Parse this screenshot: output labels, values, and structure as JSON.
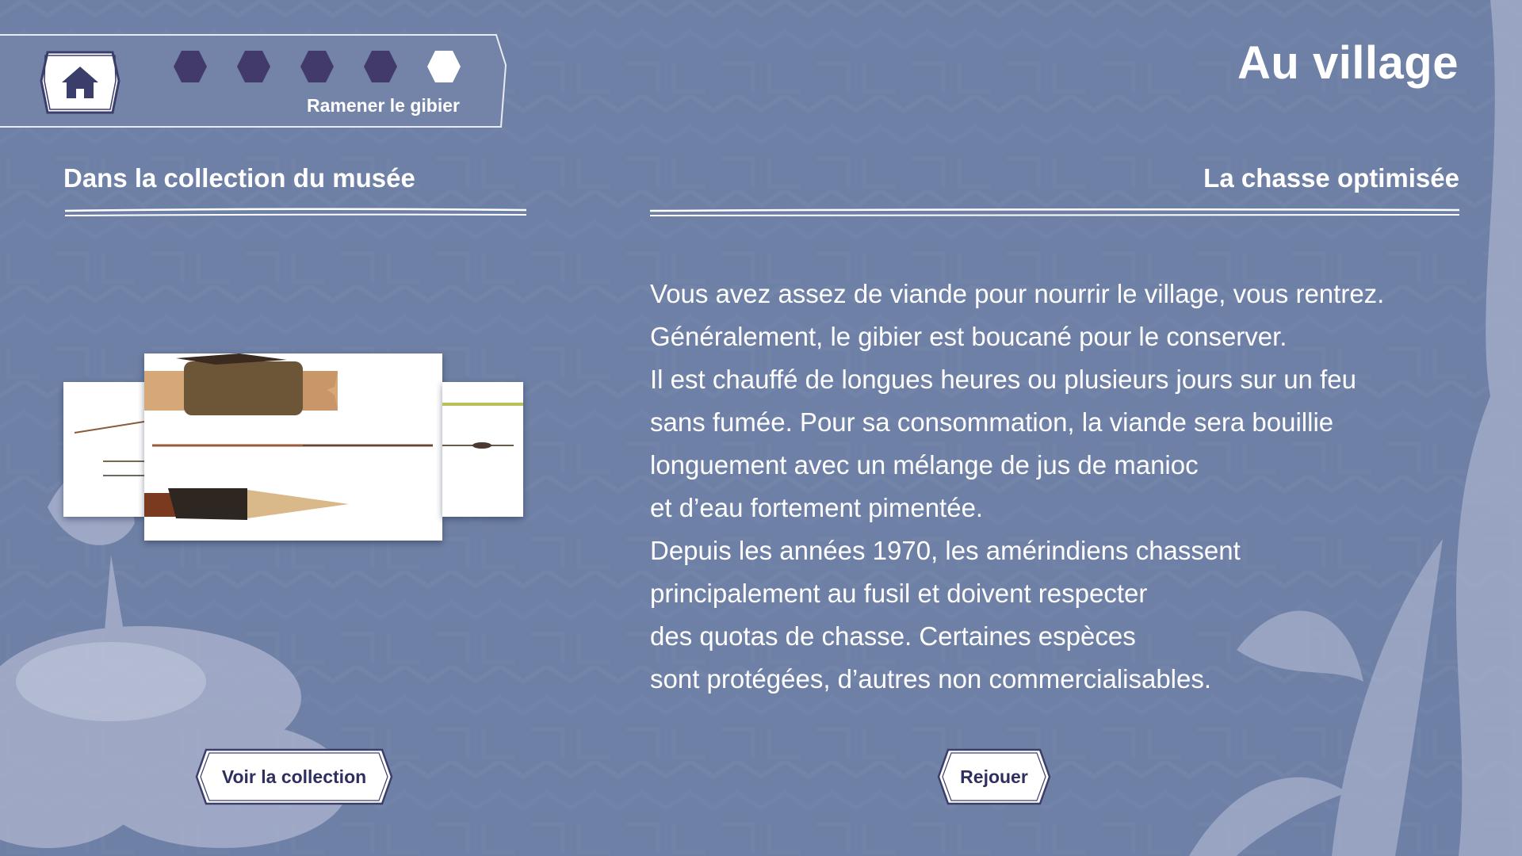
{
  "header": {
    "title": "Au village",
    "progress": {
      "steps_total": 5,
      "current_step": 5,
      "current_label": "Ramener le gibier"
    }
  },
  "left_section": {
    "title": "Dans la collection du musée",
    "button_label": "Voir la collection"
  },
  "right_section": {
    "title": "La chasse optimisée",
    "lines": [
      "Vous avez assez de viande pour nourrir le village, vous rentrez.",
      "Généralement, le gibier est boucané pour le conserver.",
      "Il est chauffé de longues heures ou plusieurs jours sur un feu",
      "sans fumée. Pour sa consommation, la viande sera bouillie",
      "longuement avec un mélange de jus de manioc",
      "et d’eau fortement pimentée.",
      "Depuis les années 1970, les amérindiens chassent",
      "principalement au fusil et doivent respecter",
      "des quotas de chasse. Certaines espèces",
      "sont protégées, d’autres non commercialisables."
    ],
    "button_label": "Rejouer"
  },
  "icons": {
    "home": "home-icon",
    "step_done": "hexagon-filled-icon",
    "step_current": "hexagon-white-icon"
  },
  "colors": {
    "background": "#6f80a6",
    "step_filled": "#433a6c",
    "step_current": "#ffffff",
    "button_text": "#2e2f5e"
  }
}
